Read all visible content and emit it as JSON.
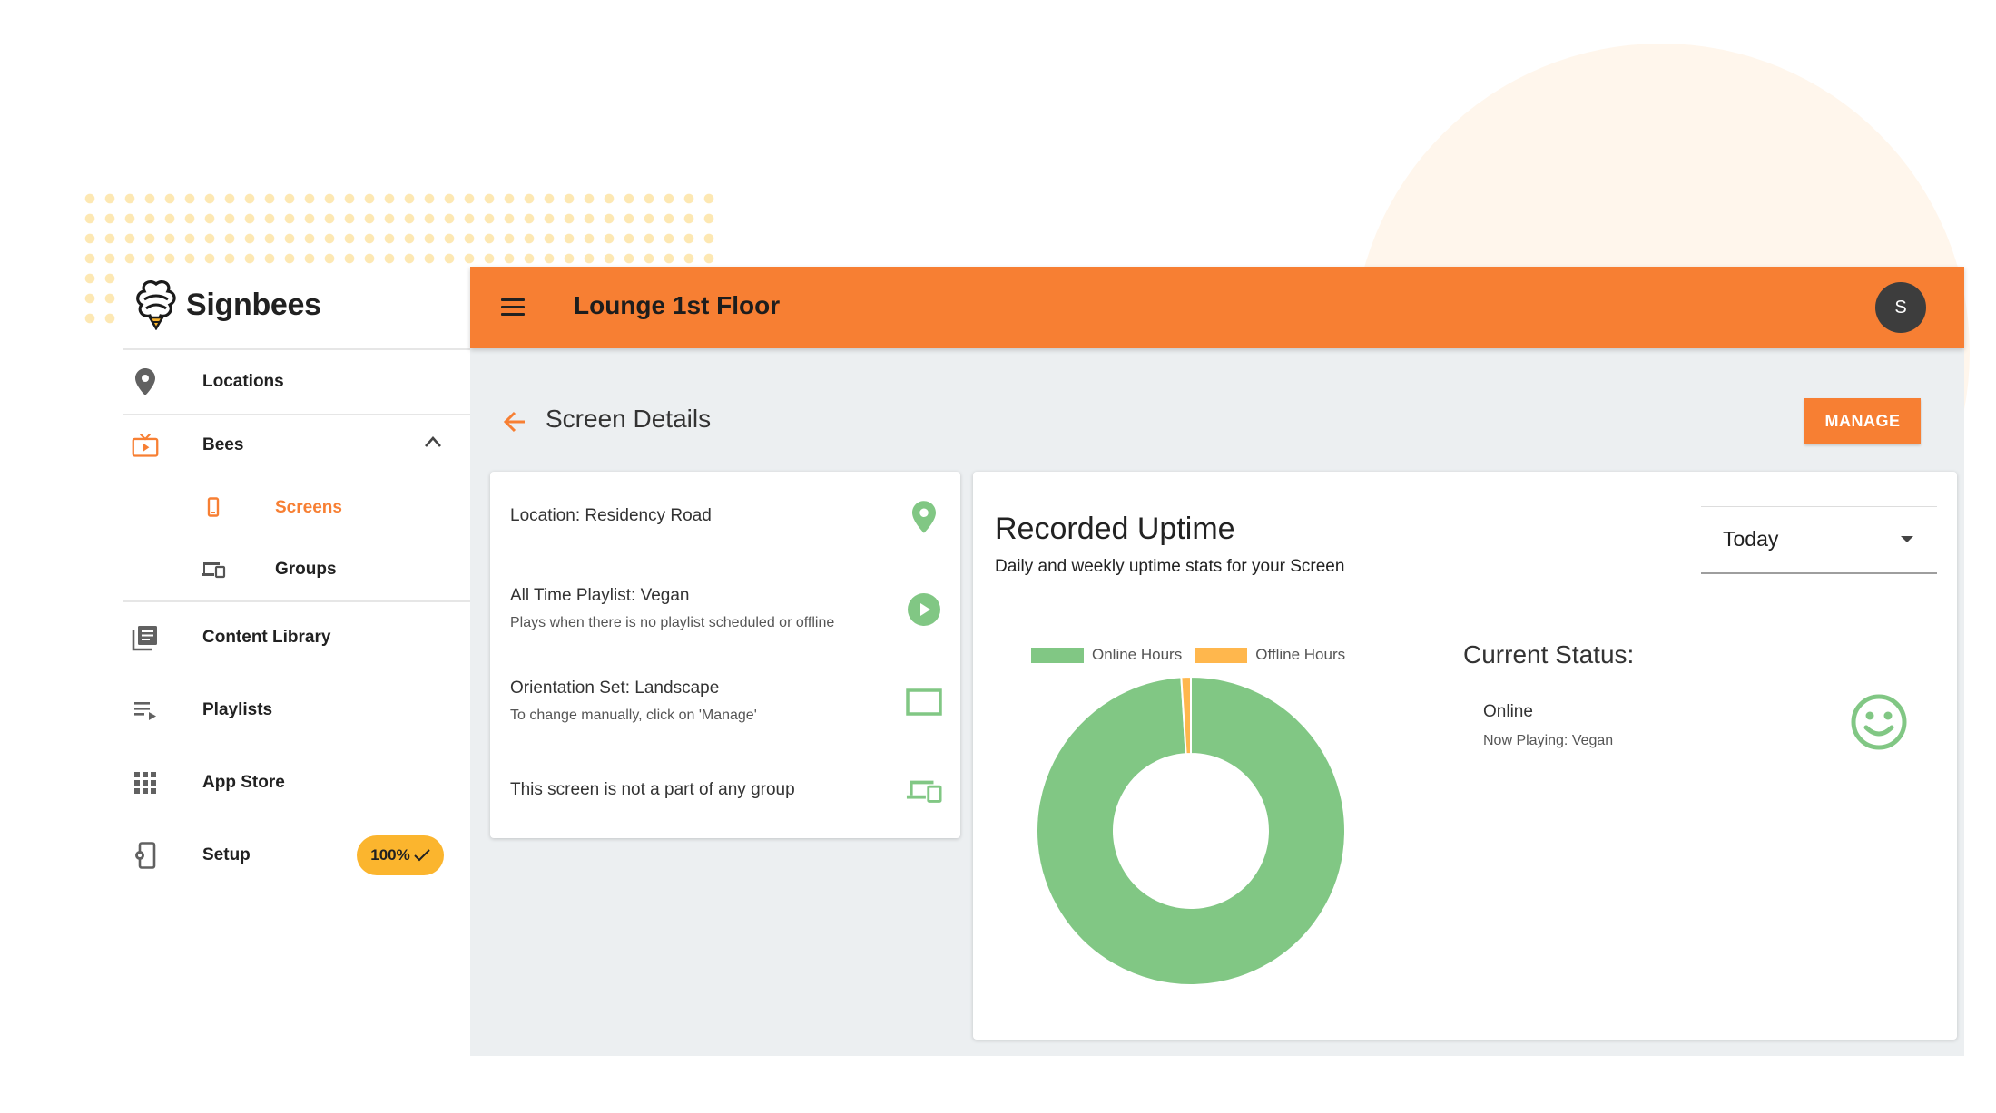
{
  "brand": {
    "name": "Signbees"
  },
  "sidebar": {
    "items": [
      {
        "label": "Locations",
        "icon": "location-pin-icon"
      },
      {
        "label": "Bees",
        "icon": "tv-play-icon",
        "expanded": true,
        "children": [
          {
            "label": "Screens",
            "icon": "phone-icon",
            "active": true
          },
          {
            "label": "Groups",
            "icon": "devices-icon"
          }
        ]
      },
      {
        "label": "Content Library",
        "icon": "library-icon"
      },
      {
        "label": "Playlists",
        "icon": "playlist-icon"
      },
      {
        "label": "App Store",
        "icon": "apps-grid-icon"
      },
      {
        "label": "Setup",
        "icon": "setup-phone-icon",
        "badge": "100%"
      }
    ]
  },
  "appbar": {
    "title": "Lounge 1st Floor",
    "avatar": "S"
  },
  "page": {
    "title": "Screen Details",
    "manage_label": "MANAGE"
  },
  "info": [
    {
      "title": "Location: Residency Road",
      "icon": "location-pin-icon"
    },
    {
      "title": "All Time Playlist: Vegan",
      "subtitle": "Plays when there is no playlist scheduled or offline",
      "icon": "play-circle-icon"
    },
    {
      "title": "Orientation Set: Landscape",
      "subtitle": "To change manually, click on 'Manage'",
      "icon": "landscape-icon"
    },
    {
      "title": "This screen is not a part of any group",
      "icon": "devices-icon"
    }
  ],
  "uptime": {
    "title": "Recorded Uptime",
    "subtitle": "Daily and weekly uptime stats for your Screen",
    "range": "Today",
    "status_title": "Current Status:",
    "status": "Online",
    "now_playing": "Now Playing: Vegan",
    "status_icon": "smiley-icon"
  },
  "chart_data": {
    "type": "pie",
    "categories": [
      "Online Hours",
      "Offline Hours"
    ],
    "values": [
      99,
      1
    ],
    "colors": [
      "#81c784",
      "#ffb74d"
    ],
    "legend": "top"
  },
  "colors": {
    "accent": "#f77f33",
    "green": "#81c784",
    "badge": "#fbb52e"
  }
}
